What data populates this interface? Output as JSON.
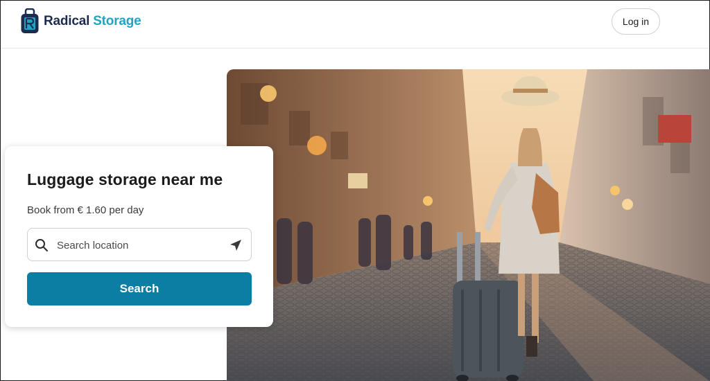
{
  "header": {
    "brand": {
      "word1": "Radical",
      "word2": "Storage"
    },
    "login_label": "Log in"
  },
  "card": {
    "title": "Luggage storage near me",
    "subtitle": "Book from € 1.60 per day",
    "search_placeholder": "Search location",
    "search_button": "Search"
  },
  "icons": {
    "logo": "suitcase-logo-icon",
    "search": "magnifier-icon",
    "locate": "navigation-arrow-icon"
  },
  "colors": {
    "brand_dark": "#1d2b4f",
    "brand_accent": "#22a3c6",
    "button": "#0d7ea3"
  }
}
